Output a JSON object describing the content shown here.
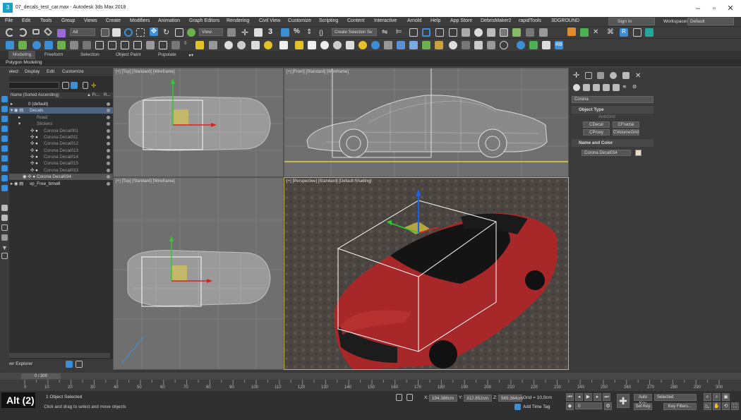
{
  "window": {
    "title": "07_decals_test_car.max - Autodesk 3ds Max 2018",
    "logo": "3"
  },
  "menu": [
    "File",
    "Edit",
    "Tools",
    "Group",
    "Views",
    "Create",
    "Modifiers",
    "Animation",
    "Graph Editors",
    "Rendering",
    "Civil View",
    "Customize",
    "Scripting",
    "Content",
    "Interactive",
    "Arnold",
    "Help",
    "App Store",
    "DebrisMaker2",
    "rapidTools",
    "3DGROUND"
  ],
  "account": {
    "signin": "Sign In",
    "workspaces_label": "Workspaces:",
    "workspace_value": "Default"
  },
  "toolbar": {
    "selection_filter": "All",
    "view_dropdown": "View",
    "selection_set": "Create Selection Se"
  },
  "ribbon": {
    "tabs": [
      "Modeling",
      "Freeform",
      "Selection",
      "Object Paint",
      "Populate"
    ],
    "panel": "Polygon Modeling"
  },
  "scene_explorer": {
    "menu": [
      "Select",
      "Display",
      "Edit",
      "Customize"
    ],
    "column_name": "Name (Sorted Ascending)",
    "column_fr": "▲ Fr...",
    "column_r": "R...",
    "rows": [
      {
        "label": "0 (default)"
      },
      {
        "label": "Decals"
      },
      {
        "label": "Road"
      },
      {
        "label": "Stickers"
      },
      {
        "label": "Corona Decal001"
      },
      {
        "label": "Corona Decal011"
      },
      {
        "label": "Corona Decal012"
      },
      {
        "label": "Corona Decal013"
      },
      {
        "label": "Corona Decal014"
      },
      {
        "label": "Corona Decal015"
      },
      {
        "label": "Corona Decal033"
      },
      {
        "label": "Corona Decal034"
      },
      {
        "label": "vp_Free_bmw8"
      }
    ],
    "layer_explorer": "Layer Explorer"
  },
  "viewports": {
    "top": "[+] [Top] [Standard] [Wireframe]",
    "front": "[+] [Front] [Standard] [Wireframe]",
    "left": "[+] [Top] [Standard] [Wireframe]",
    "persp": "[+] [Perspective] [Standard] [Default Shading]"
  },
  "command_panel": {
    "category": "Corona",
    "object_type": "Object Type",
    "autogrid": "AutoGrid",
    "buttons": [
      "CDecal",
      "CFractal",
      "CProxy",
      "CVolumeGrid"
    ],
    "name_and_color": "Name and Color",
    "object_name": "Corona Decal034",
    "color_swatch": "#e8e0c0"
  },
  "timeline": {
    "frame_counter": "0 / 300",
    "ticks": [
      "0",
      "10",
      "20",
      "30",
      "40",
      "50",
      "60",
      "70",
      "80",
      "90",
      "100",
      "110",
      "120",
      "130",
      "140",
      "150",
      "160",
      "170",
      "180",
      "190",
      "200",
      "210",
      "220",
      "230",
      "240",
      "250",
      "260",
      "270",
      "280",
      "290",
      "300"
    ]
  },
  "status": {
    "badge": "Alt (2)",
    "selection": "1 Object Selected",
    "prompt": "Click and drag to select and move objects",
    "x_label": "X:",
    "x": "194.388cm",
    "y_label": "Y:",
    "y": "312.852cm",
    "z_label": "Z:",
    "z": "569.364cm",
    "grid": "Grid = 10,0cm",
    "add_time_tag": "Add Time Tag",
    "auto_key": "Auto Key",
    "set_key": "Set Key",
    "selected": "Selected",
    "key_filters": "Key Filters...",
    "frame": "0"
  },
  "colors": {
    "accent": "#3c8fd6",
    "car": "#a8282a",
    "selection_box": "#ffffff",
    "active_viewport": "#c9b74e"
  }
}
